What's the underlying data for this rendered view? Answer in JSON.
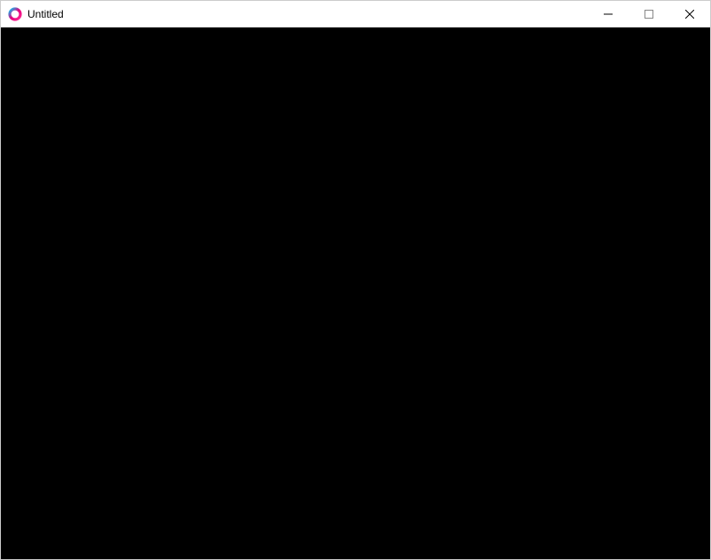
{
  "window": {
    "title": "Untitled"
  }
}
